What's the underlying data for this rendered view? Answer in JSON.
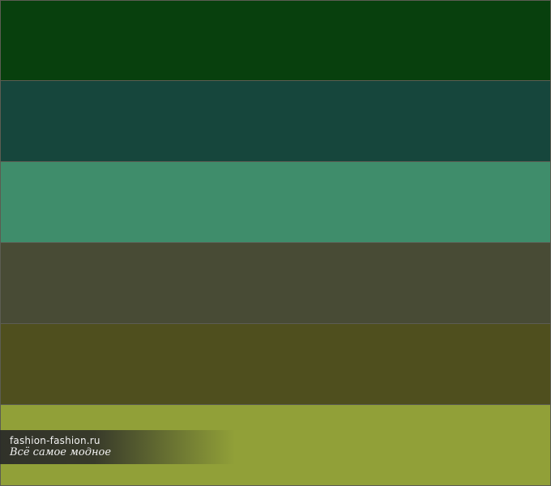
{
  "swatches": [
    {
      "id": "swatch-1",
      "color": "#08400d"
    },
    {
      "id": "swatch-2",
      "color": "#16463c"
    },
    {
      "id": "swatch-3",
      "color": "#3f8d6b"
    },
    {
      "id": "swatch-4",
      "color": "#484b35"
    },
    {
      "id": "swatch-5",
      "color": "#4f4f1e"
    },
    {
      "id": "swatch-6",
      "color": "#91a038"
    }
  ],
  "watermark": {
    "site": "fashion-fashion.ru",
    "tagline": "Всё самое модное"
  }
}
